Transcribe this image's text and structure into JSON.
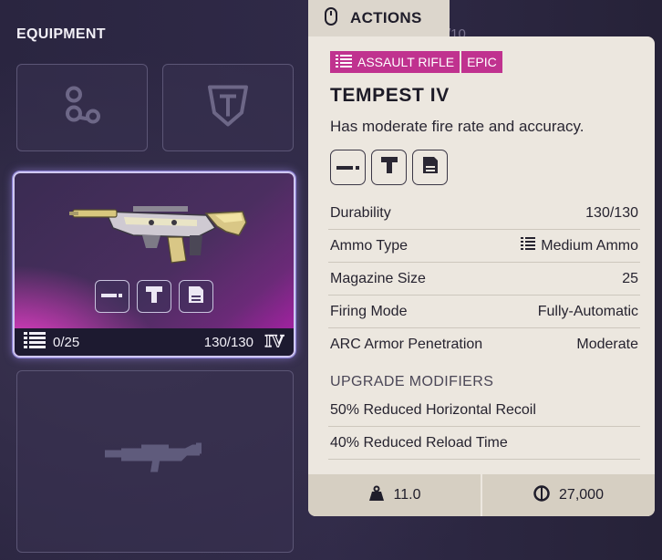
{
  "equipment": {
    "title": "EQUIPMENT",
    "slots": [
      {
        "icon": "augment-icon"
      },
      {
        "icon": "shield-icon"
      }
    ],
    "weapon_card": {
      "ammo": "0/25",
      "durability": "130/130",
      "tier": "IV",
      "mods": [
        "muzzle-mod-icon",
        "underbarrel-mod-icon",
        "magazine-mod-icon"
      ]
    },
    "secondary_slot": {
      "icon": "weapon-silhouette-icon"
    }
  },
  "actions": {
    "label": "ACTIONS",
    "icon": "mouse-icon",
    "behind_text": "/10"
  },
  "tooltip": {
    "tags": {
      "category": "ASSAULT RIFLE",
      "rarity": "EPIC"
    },
    "name": "TEMPEST IV",
    "description": "Has moderate fire rate and accuracy.",
    "attachments": [
      "muzzle-icon",
      "underbarrel-icon",
      "magazine-icon"
    ],
    "stats": [
      {
        "label": "Durability",
        "value": "130/130"
      },
      {
        "label": "Ammo Type",
        "value": "Medium Ammo",
        "icon": "ammo-icon"
      },
      {
        "label": "Magazine Size",
        "value": "25"
      },
      {
        "label": "Firing Mode",
        "value": "Fully-Automatic"
      },
      {
        "label": "ARC Armor Penetration",
        "value": "Moderate"
      }
    ],
    "upgrade_heading": "UPGRADE MODIFIERS",
    "upgrades": [
      "50% Reduced Horizontal Recoil",
      "40% Reduced Reload Time"
    ],
    "weight": "11.0",
    "price": "27,000"
  },
  "colors": {
    "background": "#2a2540",
    "epic_tag": "#c0328f",
    "tooltip_bg": "#ece7df",
    "card_glow": "#ff3fd8"
  }
}
